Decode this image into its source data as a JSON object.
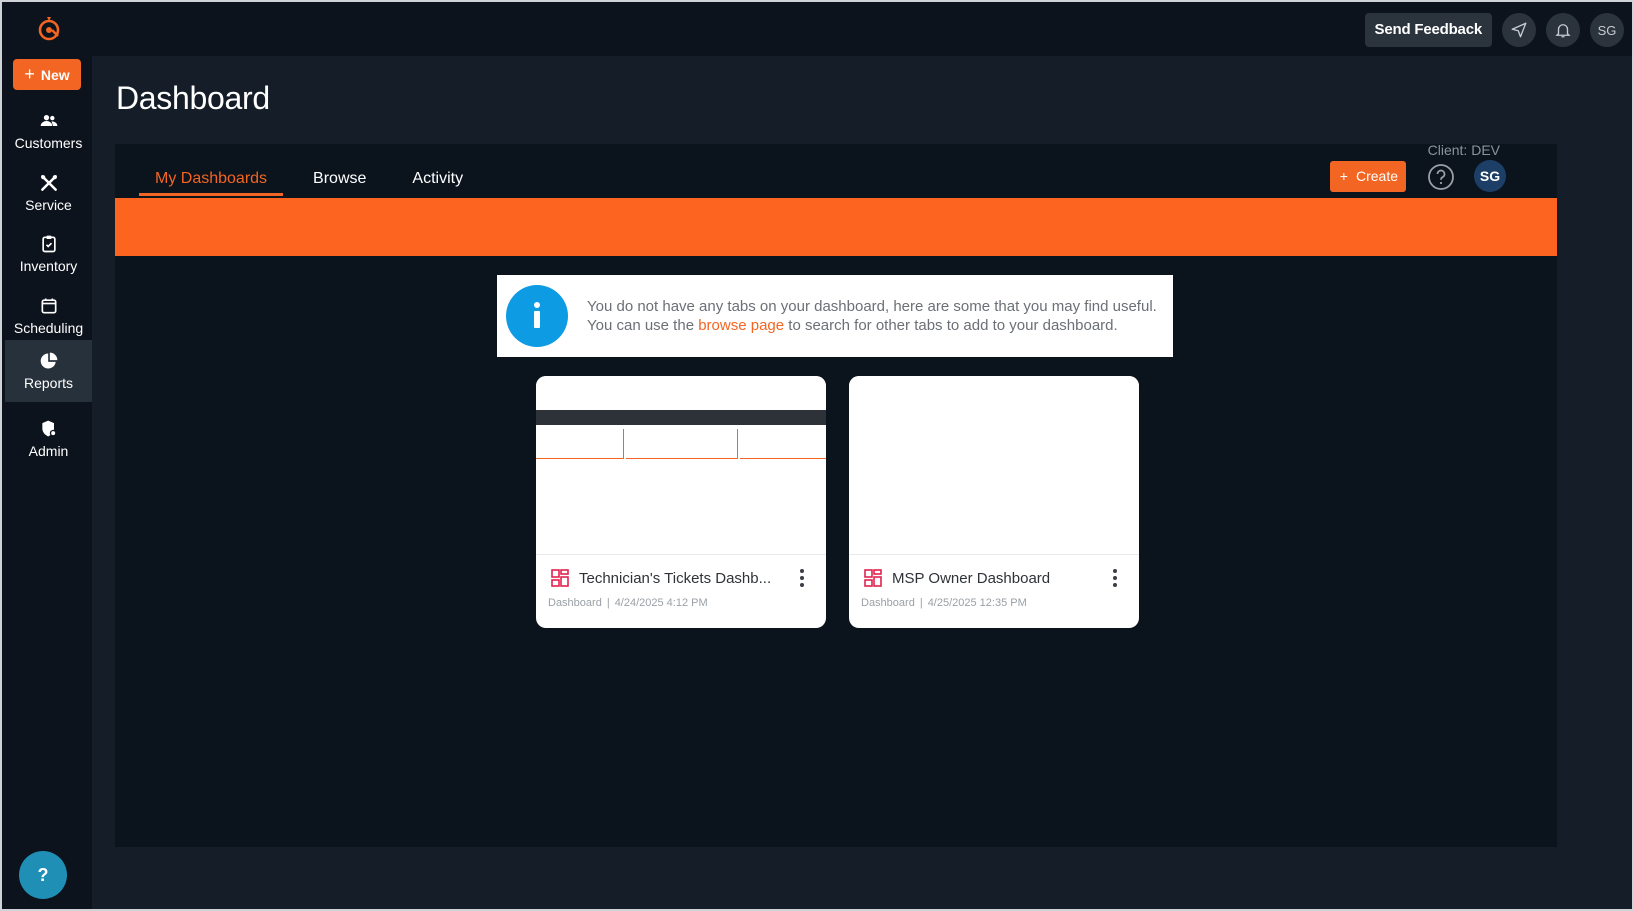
{
  "topbar": {
    "feedback_label": "Send Feedback",
    "user_initials": "SG"
  },
  "sidebar": {
    "new_label": "New",
    "items": [
      {
        "label": "Customers",
        "icon": "people-icon"
      },
      {
        "label": "Service",
        "icon": "tools-icon"
      },
      {
        "label": "Inventory",
        "icon": "clipboard-check-icon"
      },
      {
        "label": "Scheduling",
        "icon": "calendar-icon"
      },
      {
        "label": "Reports",
        "icon": "pie-chart-icon",
        "active": true
      },
      {
        "label": "Admin",
        "icon": "admin-shield-icon"
      }
    ],
    "help_label": "?"
  },
  "page": {
    "title": "Dashboard",
    "client_label": "Client: DEV",
    "tabs": [
      {
        "label": "My Dashboards",
        "active": true
      },
      {
        "label": "Browse"
      },
      {
        "label": "Activity"
      }
    ],
    "create_label": "Create",
    "avatar_initials": "SG"
  },
  "info": {
    "line1": "You do not have any tabs on your dashboard, here are some that you may find useful.",
    "line2_before": "You can use the ",
    "line2_link": "browse page",
    "line2_after": " to search for other tabs to add to your dashboard."
  },
  "cards": [
    {
      "title": "Technician's Tickets Dashb...",
      "type": "Dashboard",
      "date": "4/24/2025 4:12 PM"
    },
    {
      "title": "MSP Owner Dashboard",
      "type": "Dashboard",
      "date": "4/25/2025 12:35 PM"
    }
  ],
  "colors": {
    "accent": "#f26522",
    "info": "#0d9be4",
    "background": "#0b131c"
  }
}
